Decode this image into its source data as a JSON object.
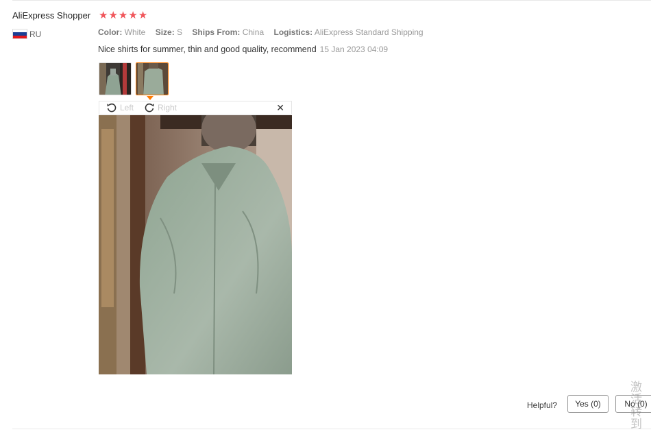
{
  "review": {
    "user_name": "AliExpress Shopper",
    "rating": 5,
    "country_code": "RU",
    "flag_colors": [
      "#ffffff",
      "#1c3f94",
      "#e4181c"
    ],
    "star_color": "#f0565b",
    "attributes": [
      {
        "label": "Color:",
        "value": "White"
      },
      {
        "label": "Size:",
        "value": "S"
      },
      {
        "label": "Ships From:",
        "value": "China"
      },
      {
        "label": "Logistics:",
        "value": "AliExpress Standard Shipping"
      }
    ],
    "text": "Nice shirts for summer, thin and good quality, recommend",
    "date": "15 Jan 2023 04:09"
  },
  "viewer": {
    "rotate_left_label": "Left",
    "rotate_right_label": "Right",
    "close_symbol": "✕",
    "selected_thumb_color": "#ff7a00"
  },
  "feedback": {
    "helpful_label": "Helpful?",
    "yes_label": "Yes (0)",
    "no_label": "No (0)"
  },
  "watermark": {
    "line1": "激活",
    "line2": "转到"
  }
}
